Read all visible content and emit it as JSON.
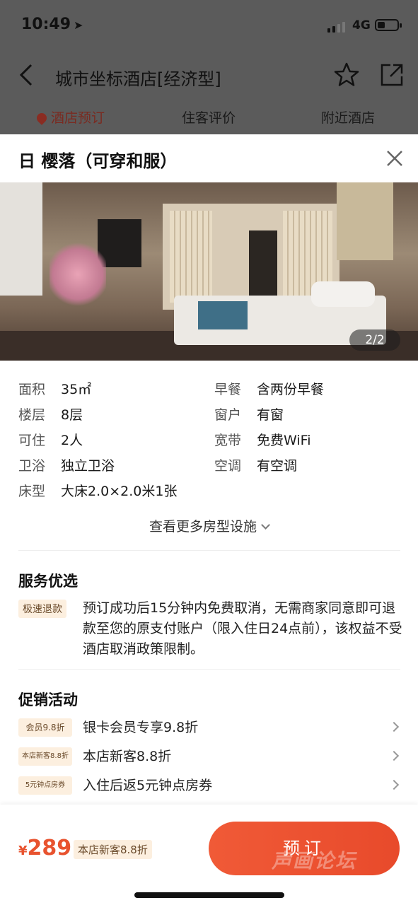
{
  "status": {
    "time": "10:49",
    "network": "4G"
  },
  "nav": {
    "title": "城市坐标酒店[经济型]"
  },
  "tabs": [
    {
      "label": "酒店预订",
      "active": true
    },
    {
      "label": "住客评价",
      "active": false
    },
    {
      "label": "附近酒店",
      "active": false
    }
  ],
  "room": {
    "title": "日 樱落（可穿和服）",
    "photo_counter": "2/2"
  },
  "facilities": [
    {
      "label": "面积",
      "value": "35㎡"
    },
    {
      "label": "早餐",
      "value": "含两份早餐"
    },
    {
      "label": "楼层",
      "value": "8层"
    },
    {
      "label": "窗户",
      "value": "有窗"
    },
    {
      "label": "可住",
      "value": "2人"
    },
    {
      "label": "宽带",
      "value": "免费WiFi"
    },
    {
      "label": "卫浴",
      "value": "独立卫浴"
    },
    {
      "label": "空调",
      "value": "有空调"
    },
    {
      "label": "床型",
      "value": "大床2.0×2.0米1张"
    }
  ],
  "more_facilities": "查看更多房型设施",
  "service": {
    "title": "服务优选",
    "tag": "极速退款",
    "desc": "预订成功后15分钟内免费取消，无需商家同意即可退款至您的原支付账户（限入住日24点前），该权益不受酒店取消政策限制。"
  },
  "promotions": {
    "title": "促销活动",
    "items": [
      {
        "tag": "会员9.8折",
        "text": "银卡会员专享9.8折"
      },
      {
        "tag": "本店新客8.8折",
        "text": "本店新客8.8折"
      },
      {
        "tag": "5元钟点房券",
        "text": "入住后返5元钟点房券"
      }
    ]
  },
  "bottom": {
    "currency": "¥",
    "price": "289",
    "price_tag": "本店新客8.8折",
    "book_label": "预订",
    "watermark": "声画论坛"
  },
  "colors": {
    "accent": "#e8532f",
    "tag_bg": "#fcefdf",
    "tab_active": "#7a2a20"
  }
}
